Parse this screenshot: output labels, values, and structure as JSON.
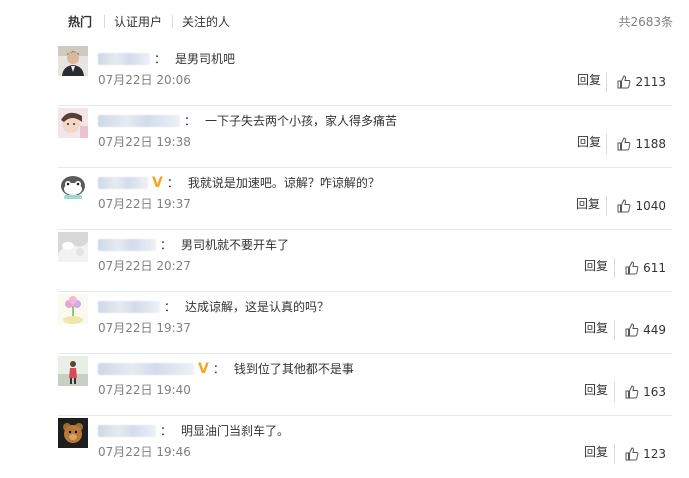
{
  "tabs": {
    "hot": "热门",
    "verified": "认证用户",
    "following": "关注的人"
  },
  "total_count": "共2683条",
  "colors": {
    "verified_badge": "#f5a623",
    "muted": "#808080",
    "divider": "#eaeaea"
  },
  "comments": [
    {
      "text": "是男司机吧",
      "time": "07月22日 20:06",
      "reply_label": "回复",
      "likes": "2113",
      "verified": false
    },
    {
      "text": "一下子失去两个小孩，家人得多痛苦",
      "time": "07月22日 19:38",
      "reply_label": "回复",
      "likes": "1188",
      "verified": false
    },
    {
      "text": "我就说是加速吧。谅解？咋谅解的？",
      "time": "07月22日 19:37",
      "reply_label": "回复",
      "likes": "1040",
      "verified": true,
      "badge": "V"
    },
    {
      "text": "男司机就不要开车了",
      "time": "07月22日 20:27",
      "reply_label": "回复",
      "likes": "611",
      "verified": false
    },
    {
      "text": "达成谅解，这是认真的吗？",
      "time": "07月22日 19:37",
      "reply_label": "回复",
      "likes": "449",
      "verified": false
    },
    {
      "text": "钱到位了其他都不是事",
      "time": "07月22日 19:40",
      "reply_label": "回复",
      "likes": "163",
      "verified": true,
      "badge": "V"
    },
    {
      "text": "明显油门当刹车了。",
      "time": "07月22日 19:46",
      "reply_label": "回复",
      "likes": "123",
      "verified": false
    }
  ]
}
